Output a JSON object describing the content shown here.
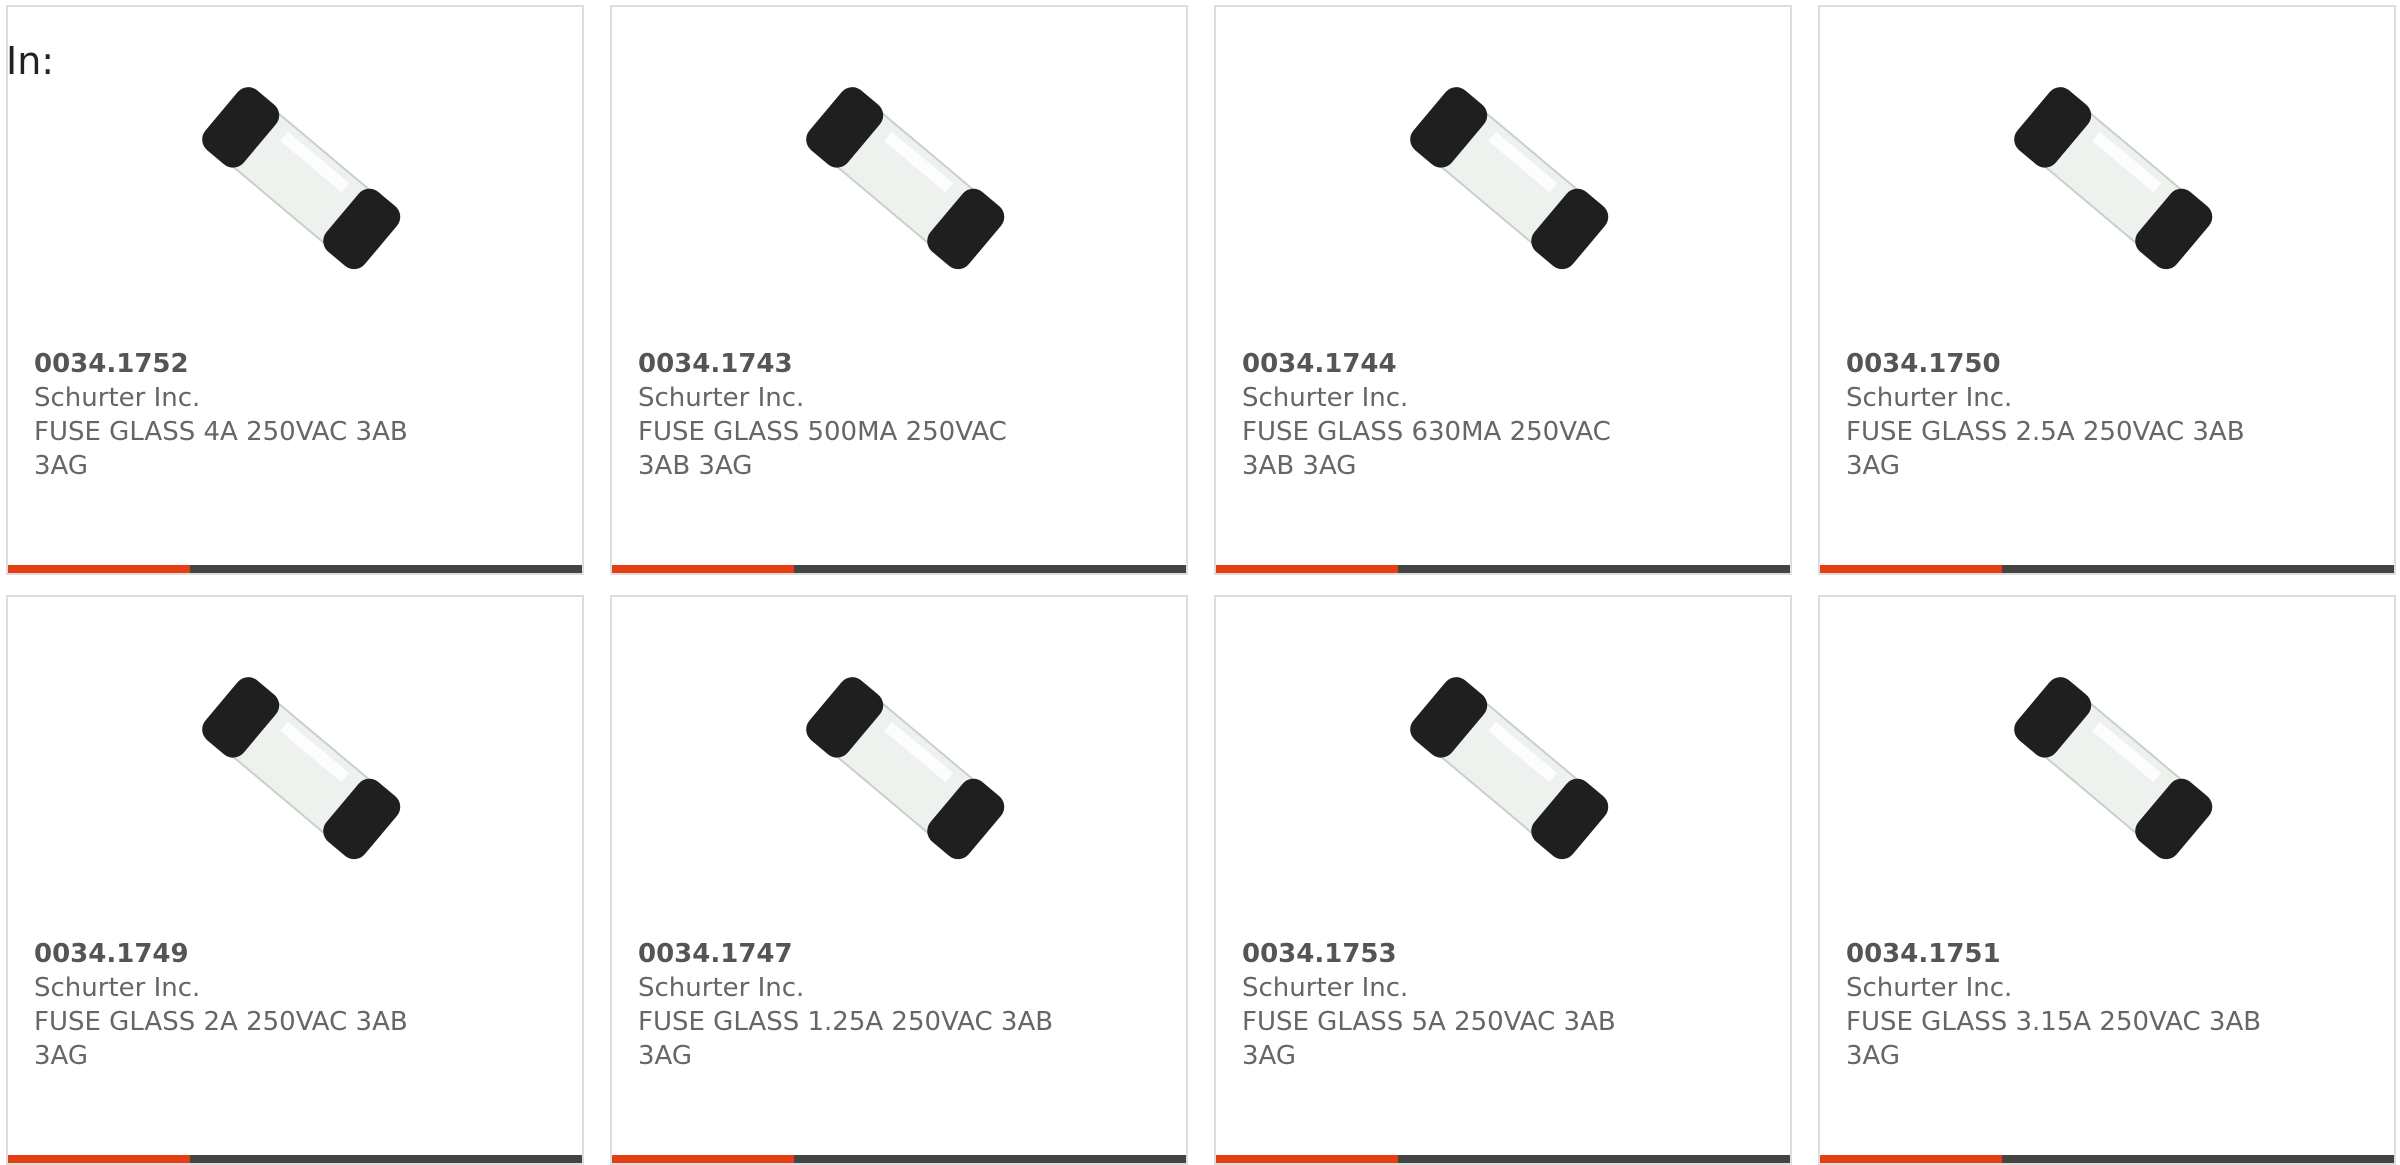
{
  "header": {
    "in_label": "In:"
  },
  "colors": {
    "accent": "#e53e13",
    "bar": "#444444",
    "border": "#dddddd",
    "text": "#666666"
  },
  "products": [
    {
      "part": "0034.1752",
      "maker": "Schurter Inc.",
      "desc": "FUSE GLASS 4A 250VAC 3AB 3AG",
      "image_icon": "glass-fuse-icon"
    },
    {
      "part": "0034.1743",
      "maker": "Schurter Inc.",
      "desc": "FUSE GLASS 500MA 250VAC 3AB 3AG",
      "image_icon": "glass-fuse-icon"
    },
    {
      "part": "0034.1744",
      "maker": "Schurter Inc.",
      "desc": "FUSE GLASS 630MA 250VAC 3AB 3AG",
      "image_icon": "glass-fuse-icon"
    },
    {
      "part": "0034.1750",
      "maker": "Schurter Inc.",
      "desc": "FUSE GLASS 2.5A 250VAC 3AB 3AG",
      "image_icon": "glass-fuse-icon"
    },
    {
      "part": "0034.1749",
      "maker": "Schurter Inc.",
      "desc": "FUSE GLASS 2A 250VAC 3AB 3AG",
      "image_icon": "glass-fuse-icon"
    },
    {
      "part": "0034.1747",
      "maker": "Schurter Inc.",
      "desc": "FUSE GLASS 1.25A 250VAC 3AB 3AG",
      "image_icon": "glass-fuse-icon"
    },
    {
      "part": "0034.1753",
      "maker": "Schurter Inc.",
      "desc": "FUSE GLASS 5A 250VAC 3AB 3AG",
      "image_icon": "glass-fuse-icon"
    },
    {
      "part": "0034.1751",
      "maker": "Schurter Inc.",
      "desc": "FUSE GLASS 3.15A 250VAC 3AB 3AG",
      "image_icon": "glass-fuse-icon"
    }
  ]
}
